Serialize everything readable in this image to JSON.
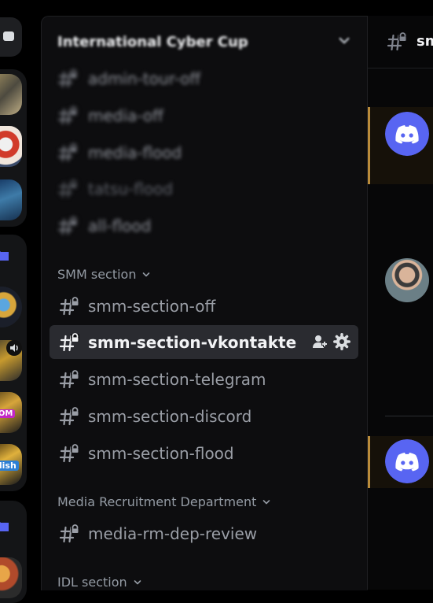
{
  "server": {
    "name": "International Cyber Cup"
  },
  "blurred_channels": [
    {
      "label": "admin-tour-off"
    },
    {
      "label": "media-off"
    },
    {
      "label": "media-flood"
    },
    {
      "label": "tatsu-flood"
    },
    {
      "label": "all-flood"
    }
  ],
  "categories": {
    "smm": {
      "label": "SMM section"
    },
    "media": {
      "label": "Media Recruitment Department"
    },
    "idl": {
      "label": "IDL section"
    }
  },
  "smm_channels": [
    {
      "label": "smm-section-off"
    },
    {
      "label": "smm-section-vkontakte"
    },
    {
      "label": "smm-section-telegram"
    },
    {
      "label": "smm-section-discord"
    },
    {
      "label": "smm-section-flood"
    }
  ],
  "media_channels": [
    {
      "label": "media-rm-dep-review"
    }
  ],
  "chat": {
    "title": "sm"
  },
  "guild_badges": {
    "custom": "TOM",
    "english": "glish"
  },
  "colors": {
    "accent": "#5865f2",
    "highlight_border": "#b98b3a",
    "active_row": "#2a2b30"
  }
}
